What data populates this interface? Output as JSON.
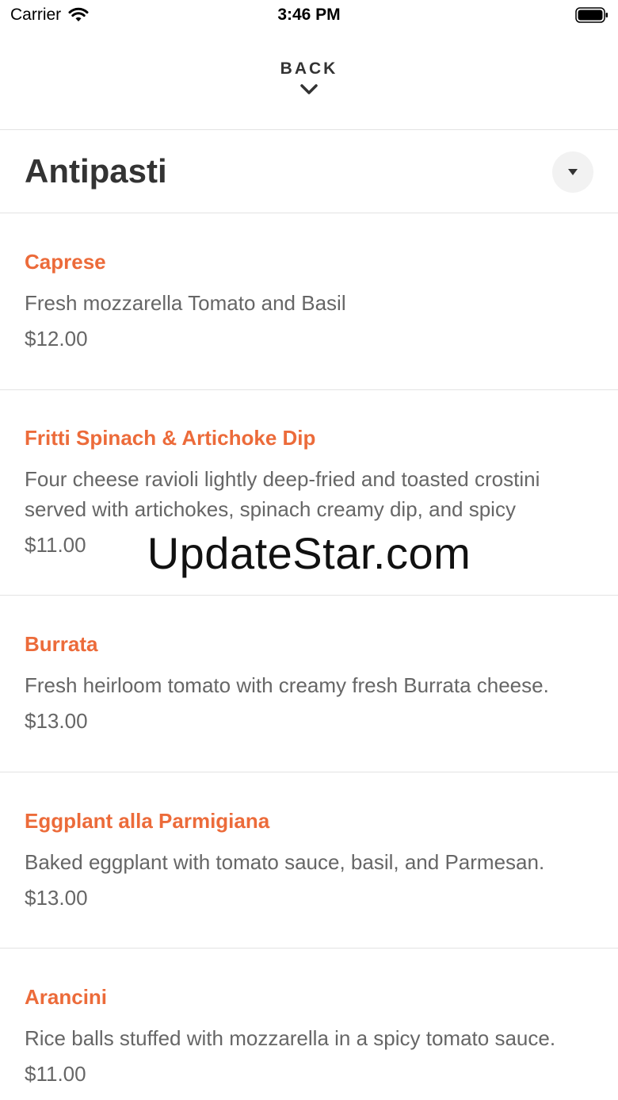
{
  "status_bar": {
    "carrier": "Carrier",
    "time": "3:46 PM",
    "wifi_icon": "wifi-icon",
    "battery_icon": "battery-icon"
  },
  "nav": {
    "back_label": "BACK",
    "back_icon": "chevron-down-icon"
  },
  "section": {
    "title": "Antipasti",
    "dropdown_icon": "caret-down-icon"
  },
  "accent_color": "#ec6b3a",
  "items": [
    {
      "name": "Caprese",
      "description": "Fresh mozzarella Tomato and Basil",
      "price": "$12.00"
    },
    {
      "name": "Fritti Spinach & Artichoke Dip",
      "description": "Four cheese ravioli lightly deep-fried and toasted crostini served with artichokes, spinach creamy dip, and spicy",
      "price": "$11.00"
    },
    {
      "name": "Burrata",
      "description": "Fresh heirloom tomato with creamy fresh Burrata cheese.",
      "price": "$13.00"
    },
    {
      "name": "Eggplant alla Parmigiana",
      "description": "Baked eggplant with tomato sauce, basil, and Parmesan.",
      "price": "$13.00"
    },
    {
      "name": "Arancini",
      "description": "Rice balls stuffed with mozzarella in a spicy tomato sauce.",
      "price": "$11.00"
    }
  ],
  "watermark": "UpdateStar.com"
}
